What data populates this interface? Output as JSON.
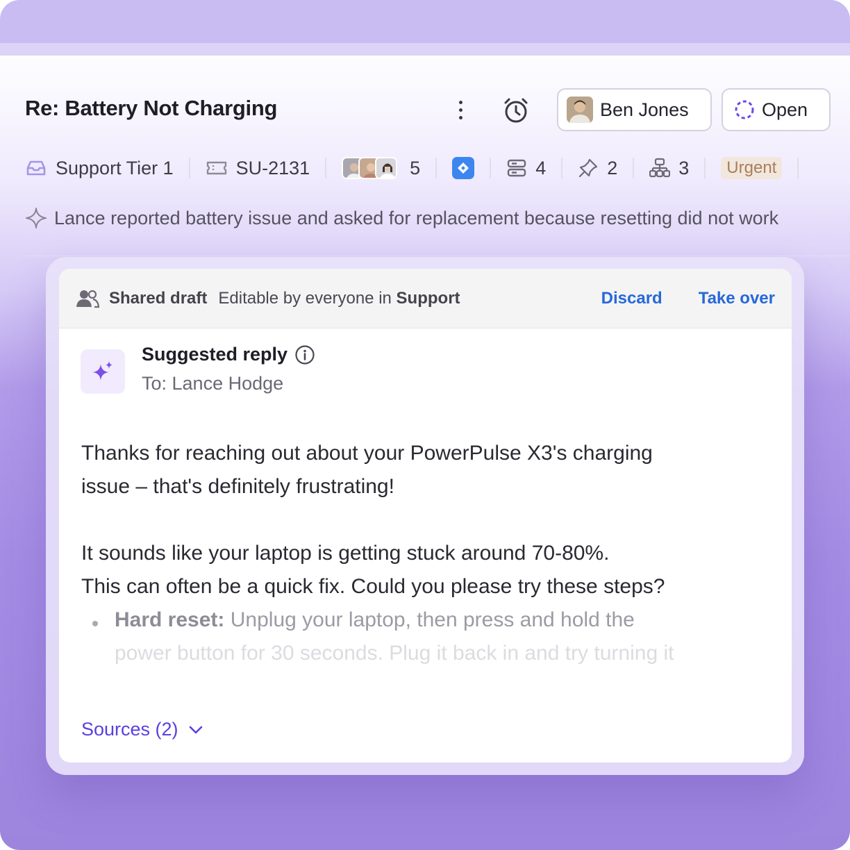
{
  "header": {
    "title": "Re: Battery Not Charging",
    "assignee": "Ben Jones",
    "status": "Open"
  },
  "meta": {
    "team": "Support Tier 1",
    "ticket_id": "SU-2131",
    "participants_count": "5",
    "linked_count": "4",
    "pinned_count": "2",
    "hierarchy_count": "3",
    "priority": "Urgent"
  },
  "summary": "Lance reported battery issue and asked for replacement because resetting did not work",
  "draft": {
    "label": "Shared draft",
    "editable_prefix": "Editable by everyone in",
    "editable_group": "Support",
    "discard": "Discard",
    "take_over": "Take over"
  },
  "reply": {
    "title": "Suggested reply",
    "to": "To: Lance Hodge",
    "para1_line1": "Thanks for reaching out about your PowerPulse X3's charging",
    "para1_line2": "issue – that's definitely frustrating!",
    "para2_line1": "It sounds like your laptop is getting stuck around 70-80%.",
    "para2_line2": "This can often be a quick fix. Could you please try these steps?",
    "bullet_label": "Hard reset:",
    "bullet_text": " Unplug your laptop, then press and hold the",
    "bullet_line2": "power button for 30 seconds. Plug it back in and try turning it",
    "sources": "Sources (2)"
  },
  "colors": {
    "accent": "#5b3fe0",
    "link": "#2768d8",
    "urgent_bg": "#f2e7dc",
    "urgent_text": "#a97e5c"
  }
}
